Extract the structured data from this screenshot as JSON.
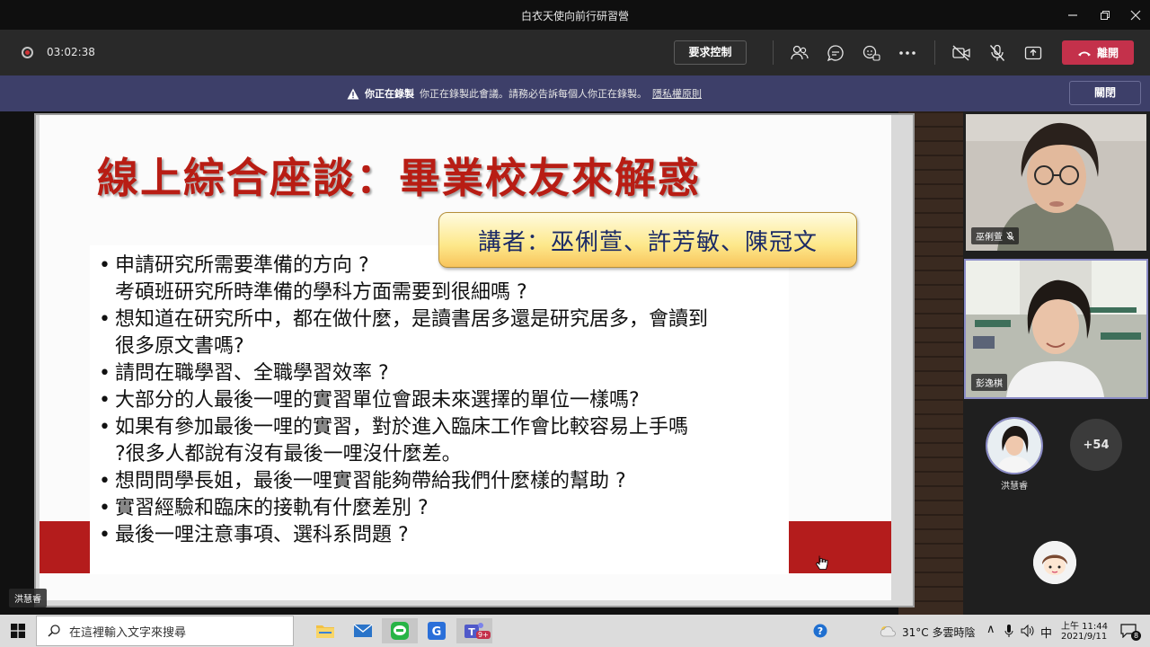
{
  "window": {
    "title": "白衣天使向前行研習營"
  },
  "toolbar": {
    "timer": "03:02:38",
    "request_control_label": "要求控制",
    "leave_label": "離開"
  },
  "banner": {
    "bold": "你正在錄製",
    "message": "你正在錄製此會議。請務必告訴每個人你正在錄製。",
    "link": "隱私權原則",
    "close_label": "關閉"
  },
  "slide": {
    "title": "線上綜合座談：畢業校友來解惑",
    "speakers": "講者：巫俐萱、許芳敏、陳冠文",
    "bullets": [
      {
        "text": "申請研究所需要準備的方向 ?",
        "continued": false
      },
      {
        "text": "考碩班研究所時準備的學科方面需要到很細嗎 ?",
        "continued": true
      },
      {
        "text": "想知道在研究所中，都在做什麼，是讀書居多還是研究居多，會讀到",
        "continued": false
      },
      {
        "text": "很多原文書嗎?",
        "continued": true
      },
      {
        "text": "請問在職學習、全職學習效率 ?",
        "continued": false
      },
      {
        "text": "大部分的人最後一哩的實習單位會跟未來選擇的單位一樣嗎?",
        "continued": false
      },
      {
        "text": "如果有參加最後一哩的實習，對於進入臨床工作會比較容易上手嗎",
        "continued": false
      },
      {
        "text": "?很多人都說有沒有最後一哩沒什麼差。",
        "continued": true
      },
      {
        "text": "想問問學長姐，最後一哩實習能夠帶給我們什麼樣的幫助 ?",
        "continued": false
      },
      {
        "text": "實習經驗和臨床的接軌有什麼差別 ?",
        "continued": false
      },
      {
        "text": "最後一哩注意事項、選科系問題 ?",
        "continued": false
      }
    ],
    "presenter": "洪慧睿"
  },
  "participants": {
    "tile1_name": "巫俐萱",
    "tile2_name": "彭逸棋",
    "avatar_name": "洪慧睿",
    "more_count": "+54"
  },
  "taskbar": {
    "search_placeholder": "在這裡輸入文字來搜尋",
    "weather": "31°C  多雲時陰",
    "ime": "中",
    "time": "上午 11:44",
    "date": "2021/9/11",
    "notification_count": "8",
    "teams_badge": "9+"
  },
  "colors": {
    "leave": "#c4314b",
    "banner": "#3d3f69",
    "slide_title": "#b81d14",
    "slide_band": "#b41c1c"
  }
}
